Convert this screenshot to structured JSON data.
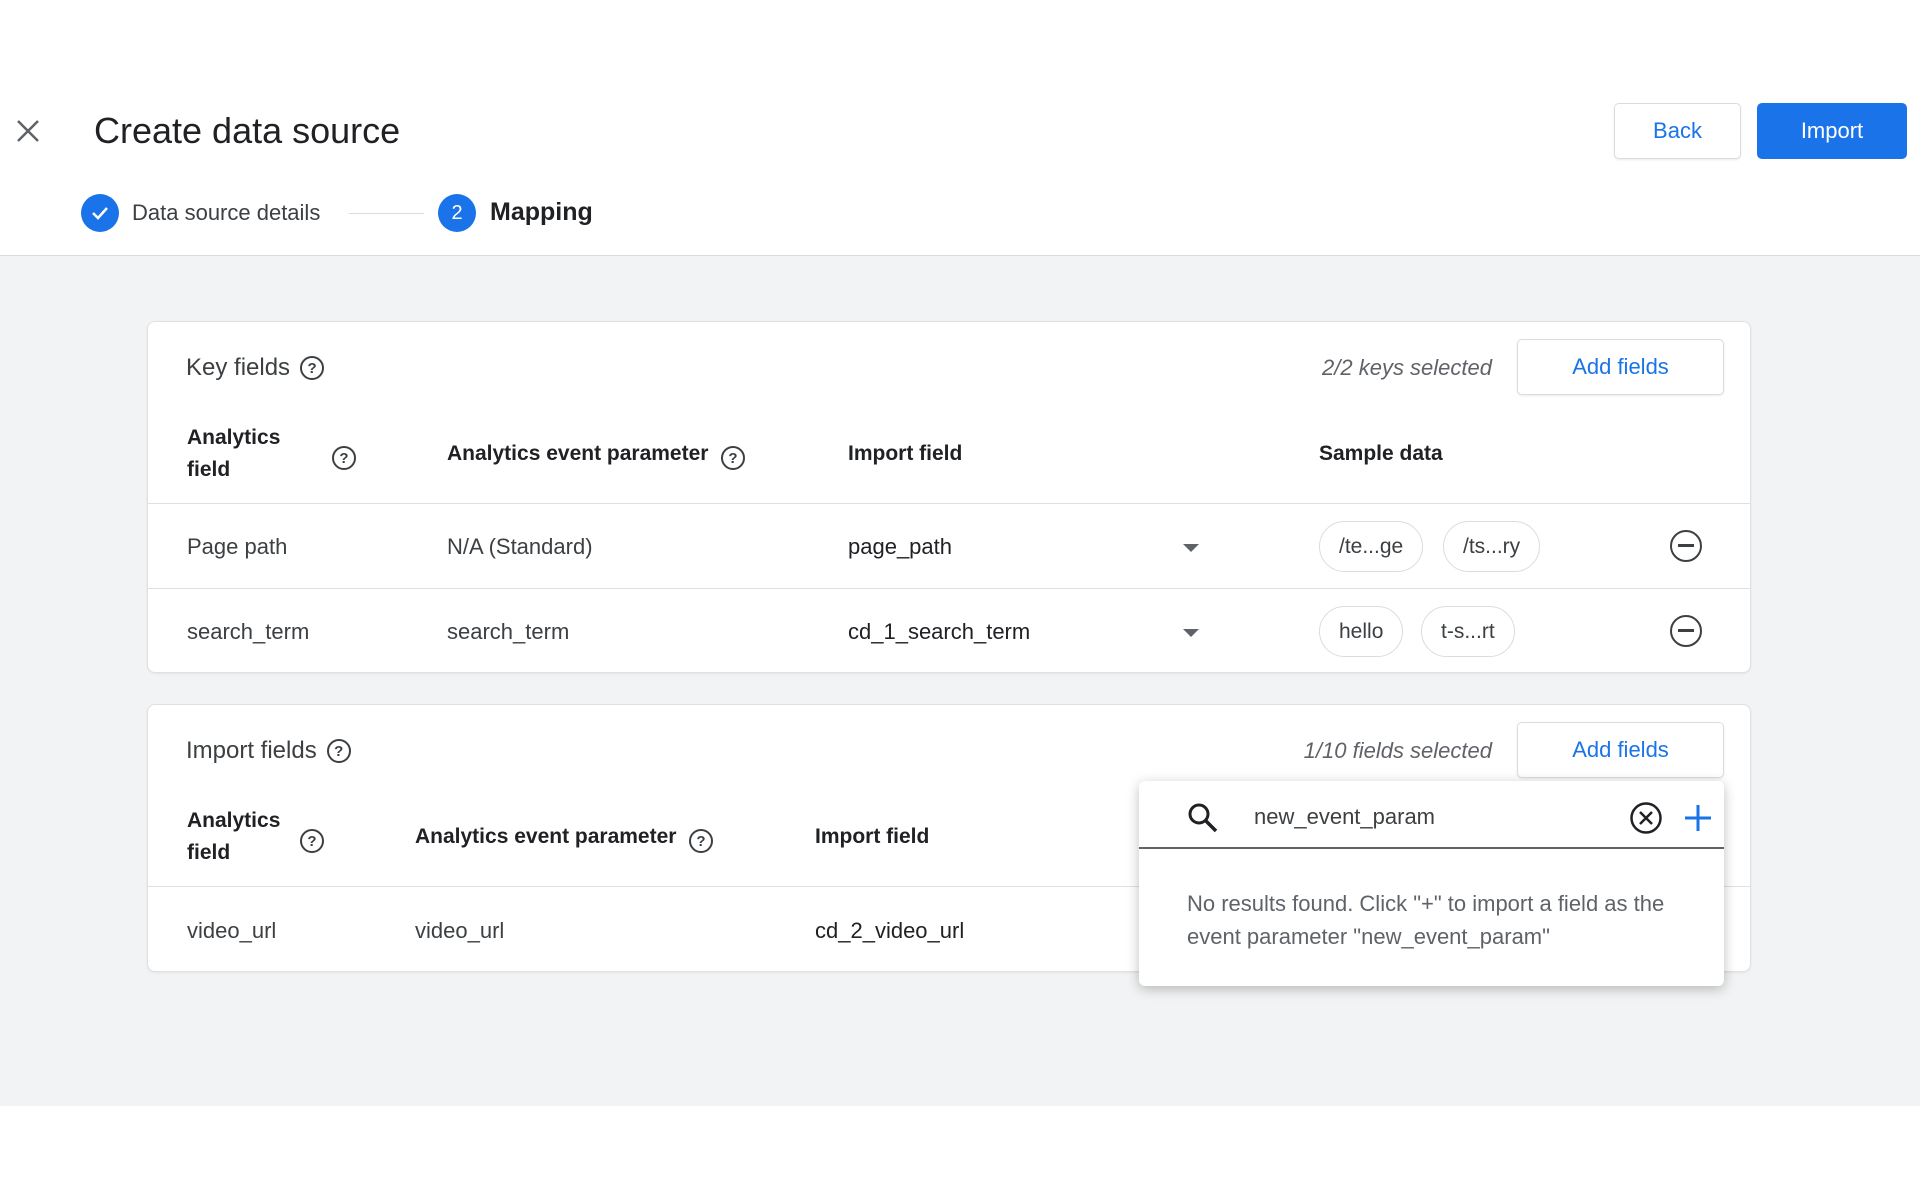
{
  "header": {
    "title": "Create data source",
    "back_label": "Back",
    "import_label": "Import",
    "steps": [
      {
        "label": "Data source details",
        "state": "complete"
      },
      {
        "number": "2",
        "label": "Mapping",
        "state": "active"
      }
    ]
  },
  "key_fields": {
    "title": "Key fields",
    "count": "2/2 keys selected",
    "add_label": "Add fields",
    "columns": [
      "Analytics field",
      "Analytics event parameter",
      "Import field",
      "Sample data"
    ],
    "rows": [
      {
        "analytics_field": "Page path",
        "event_parameter": "N/A (Standard)",
        "import_field": "page_path",
        "samples": [
          "/te...ge",
          "/ts...ry"
        ]
      },
      {
        "analytics_field": "search_term",
        "event_parameter": "search_term",
        "import_field": "cd_1_search_term",
        "samples": [
          "hello",
          "t-s...rt"
        ]
      }
    ]
  },
  "import_fields": {
    "title": "Import fields",
    "count": "1/10 fields selected",
    "add_label": "Add fields",
    "columns": [
      "Analytics field",
      "Analytics event parameter",
      "Import field"
    ],
    "rows": [
      {
        "analytics_field": "video_url",
        "event_parameter": "video_url",
        "import_field": "cd_2_video_url"
      }
    ]
  },
  "popup": {
    "search_value": "new_event_param",
    "message": "No results found. Click \"+\" to import a field as the event parameter \"new_event_param\""
  },
  "colors": {
    "accent": "#1a73e8",
    "background": "#f1f3f4"
  }
}
